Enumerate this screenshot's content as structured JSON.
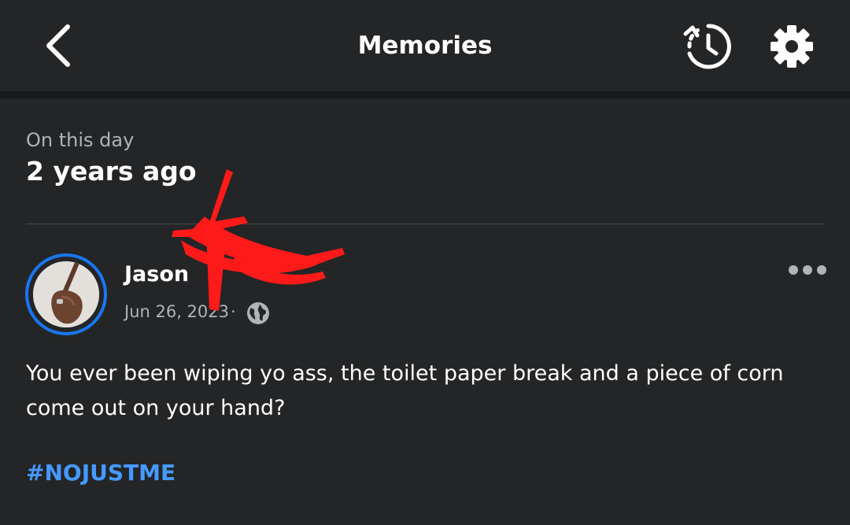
{
  "header": {
    "title": "Memories",
    "back_icon": "chevron-left-icon",
    "history_icon": "history-icon",
    "settings_icon": "gear-icon"
  },
  "memory": {
    "subtitle": "On this day",
    "heading": "2 years ago"
  },
  "post": {
    "author": "Jason",
    "date": "Jun 26, 2023",
    "separator": "·",
    "privacy_icon": "globe-icon",
    "more_icon": "more-dots-icon",
    "text": "You ever been wiping yo ass,  the toilet paper break and a piece of corn come out on your hand?",
    "hashtag": "#NOJUSTME"
  },
  "colors": {
    "background": "#242526",
    "accent": "#1877f2",
    "hashtag": "#4599ff",
    "redaction": "#ff1a1a"
  }
}
